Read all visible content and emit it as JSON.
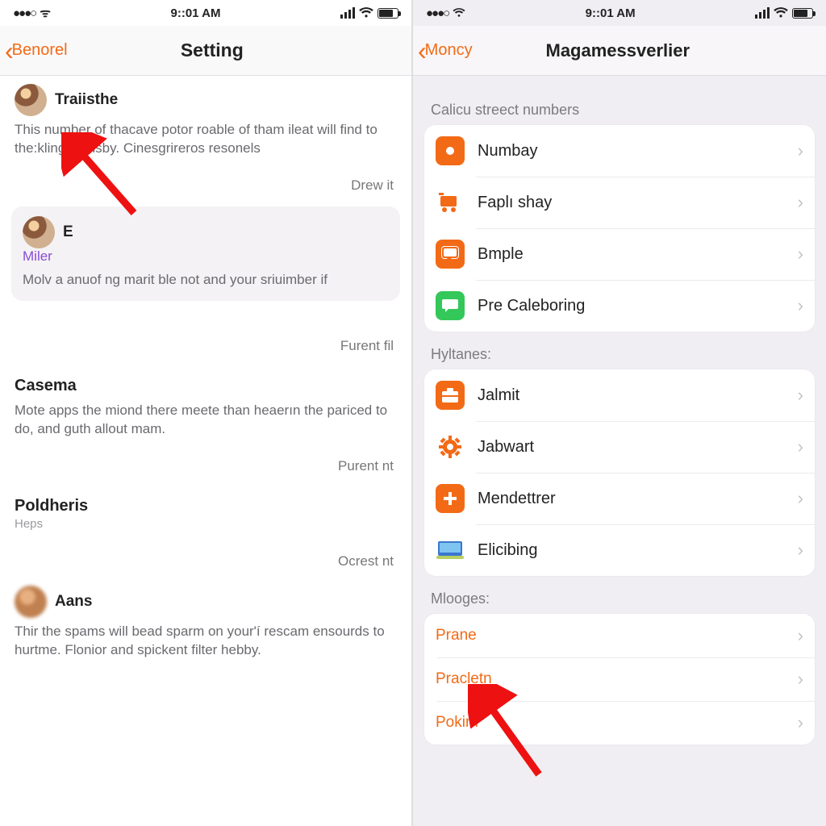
{
  "left": {
    "status": {
      "time": "9::01 AM",
      "carrier_dots": "●●●○",
      "carrier_label": "ᯤ"
    },
    "nav": {
      "back": "Benorel",
      "title": "Setting"
    },
    "posts": [
      {
        "user": "Traiisthe",
        "body": "This number of thacave potor roable of tham ileat will find to the:kling, censby. Cinesgrireros resonels",
        "meta": "Drew it"
      }
    ],
    "card": {
      "user": "E",
      "tag": "Miler",
      "body": "Molv a anuof ng marit ble not and your sriuimber if"
    },
    "meta2": "Furent fil",
    "section2": {
      "title": "Casema",
      "body": "Mote apps the miond there meete than heaerın the pariced to do, and guth allout mam.",
      "meta": "Purent nt"
    },
    "section3": {
      "title": "Poldheris",
      "sub": "Heps",
      "meta": "Ocrest nt"
    },
    "section4": {
      "user": "Aans",
      "body": "Thir the spams will bead sparm on your'í rescam ensourds to hurtme. Flonior and spickent filter hebby."
    }
  },
  "right": {
    "status": {
      "time": "9::01 AM",
      "carrier_dots": "●●●○"
    },
    "nav": {
      "back": "Moncy",
      "title": "Magamessverlier"
    },
    "group1": {
      "label": "Calicu streect numbers",
      "items": [
        {
          "icon": "square-dot-icon",
          "label": "Numbay"
        },
        {
          "icon": "cart-icon",
          "label": "Faplı shay"
        },
        {
          "icon": "chat-icon",
          "label": "Bmple"
        },
        {
          "icon": "message-icon",
          "label": "Pre Caleboring"
        }
      ]
    },
    "group2": {
      "label": "Hyltanes:",
      "items": [
        {
          "icon": "briefcase-icon",
          "label": "Jalmit"
        },
        {
          "icon": "gear-icon",
          "label": "Jabwart"
        },
        {
          "icon": "plus-circle-icon",
          "label": "Mendettrer"
        },
        {
          "icon": "screen-icon",
          "label": "Elicibing"
        }
      ]
    },
    "group3": {
      "label": "Mlooges:",
      "items": [
        {
          "label": "Prane"
        },
        {
          "label": "Pracletn"
        },
        {
          "label": "Pokim"
        }
      ]
    }
  }
}
